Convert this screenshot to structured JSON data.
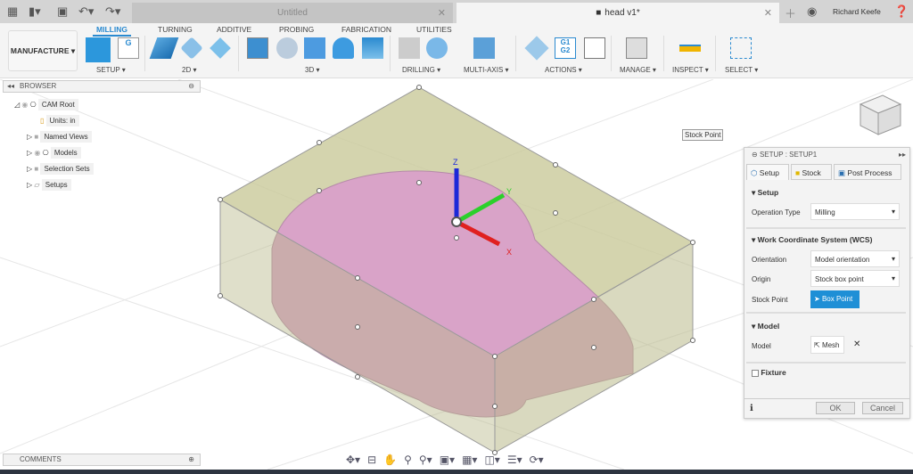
{
  "quick_access": {
    "grid": "grid-icon",
    "file": "file-icon",
    "save": "save-icon",
    "undo": "undo-icon",
    "redo": "redo-icon"
  },
  "tabs": [
    {
      "label": "Untitled",
      "active": false
    },
    {
      "label": "head v1*",
      "active": true
    }
  ],
  "user": {
    "name": "Richard Keefe"
  },
  "toolbar": {
    "workspace": "MANUFACTURE ▾",
    "tabs": [
      "MILLING",
      "TURNING",
      "ADDITIVE",
      "PROBING",
      "FABRICATION",
      "UTILITIES"
    ],
    "groups": [
      "SETUP ▾",
      "2D ▾",
      "3D ▾",
      "DRILLING ▾",
      "MULTI-AXIS ▾",
      "ACTIONS ▾",
      "MANAGE ▾",
      "INSPECT ▾",
      "SELECT ▾"
    ]
  },
  "browser": {
    "title": "BROWSER",
    "items": [
      "CAM Root",
      "Units: in",
      "Named Views",
      "Models",
      "Selection Sets",
      "Setups"
    ]
  },
  "tooltip": "Stock Point",
  "axes": {
    "x": "X",
    "y": "Y",
    "z": "Z"
  },
  "panel": {
    "title": "SETUP : SETUP1",
    "tabs": [
      "Setup",
      "Stock",
      "Post Process"
    ],
    "setup_section": "Setup",
    "operation_type_label": "Operation Type",
    "operation_type": "Milling",
    "wcs_section": "Work Coordinate System (WCS)",
    "orientation_label": "Orientation",
    "orientation": "Model orientation",
    "origin_label": "Origin",
    "origin": "Stock box point",
    "stock_point_label": "Stock Point",
    "stock_point": "Box Point",
    "model_section": "Model",
    "model_label": "Model",
    "model": "Mesh",
    "fixture": "Fixture",
    "fixture_checked": false,
    "ok": "OK",
    "cancel": "Cancel",
    "accent": "#1e8fd6"
  },
  "comments": {
    "title": "COMMENTS"
  },
  "colors": {
    "stock": "#b9b98a",
    "model": "#d9a3c8"
  }
}
